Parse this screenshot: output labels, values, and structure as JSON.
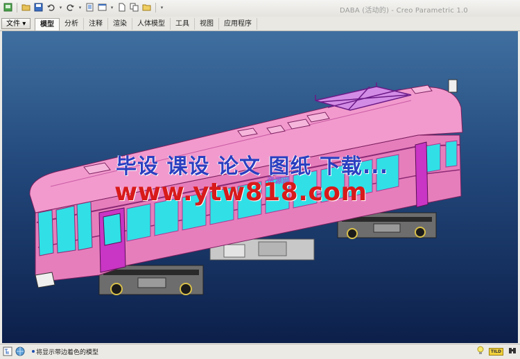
{
  "app": {
    "title": "DABA (活动的) - Creo Parametric 1.0"
  },
  "quick_access": {
    "icons": [
      "new-session-icon",
      "open-icon",
      "save-icon",
      "undo-icon",
      "redo-icon",
      "regenerate-icon",
      "windows-icon",
      "new-file-icon",
      "copy-icon",
      "folder-icon",
      "customize-icon"
    ]
  },
  "ribbon": {
    "file_label": "文件",
    "file_arrow": "▾",
    "tabs": [
      {
        "label": "模型",
        "active": true
      },
      {
        "label": "分析",
        "active": false
      },
      {
        "label": "注释",
        "active": false
      },
      {
        "label": "渲染",
        "active": false
      },
      {
        "label": "人体模型",
        "active": false
      },
      {
        "label": "工具",
        "active": false
      },
      {
        "label": "视图",
        "active": false
      },
      {
        "label": "应用程序",
        "active": false
      }
    ]
  },
  "watermark": {
    "line1": "毕设 课设 论文 图纸 下载...",
    "line2": "www.ytw818.com",
    "logo": "资源网"
  },
  "status": {
    "message": "将显示带边着色的模型",
    "badge": "TILD"
  },
  "colors": {
    "body": "#e77ebc",
    "roof": "#f29acd",
    "window": "#30e0e6",
    "frame": "#c935c4",
    "background_top": "#3f6fa0",
    "background_bottom": "#0c1f4a"
  }
}
